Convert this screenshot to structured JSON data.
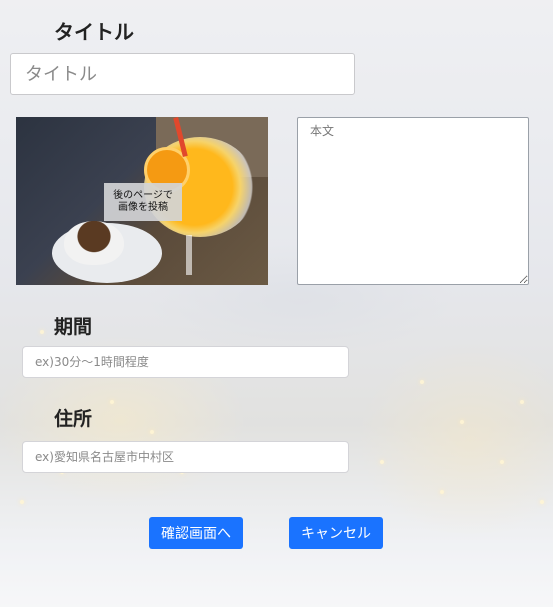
{
  "form": {
    "title_label": "タイトル",
    "title_placeholder": "タイトル",
    "image_caption": "後のページで\n画像を投稿",
    "body_placeholder": "本文",
    "period_label": "期間",
    "period_placeholder": "ex)30分〜1時間程度",
    "address_label": "住所",
    "address_placeholder": "ex)愛知県名古屋市中村区"
  },
  "buttons": {
    "confirm_label": "確認画面へ",
    "cancel_label": "キャンセル"
  },
  "colors": {
    "button": "#1a73ff",
    "button_text": "#ffffff"
  }
}
